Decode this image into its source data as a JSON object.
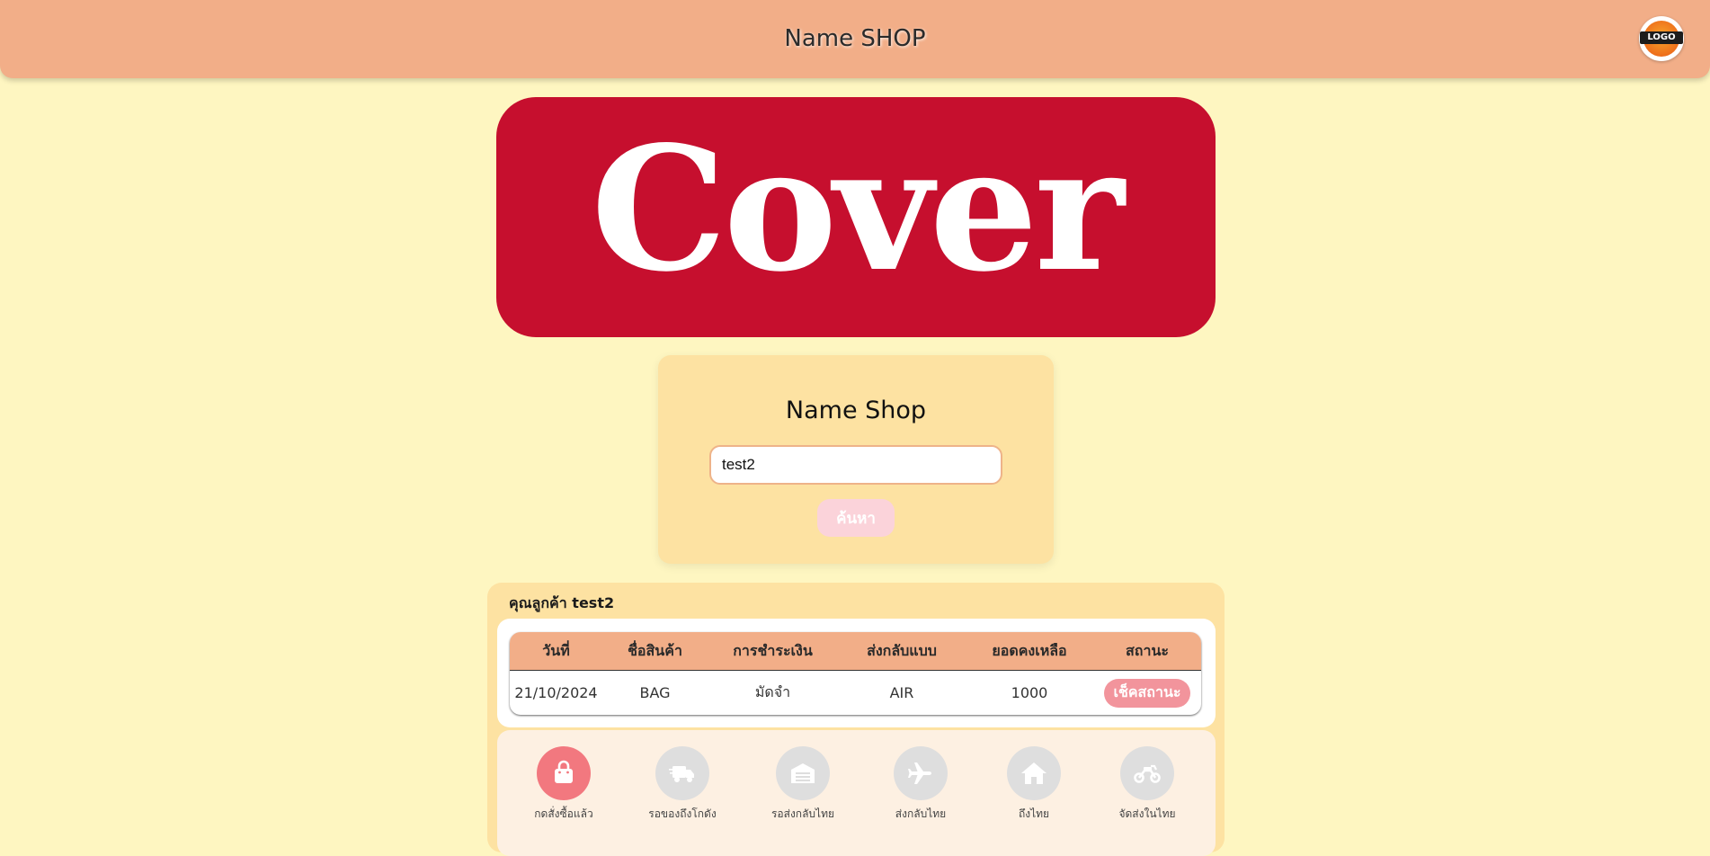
{
  "header": {
    "title": "Name SHOP",
    "logo_text": "LOGO"
  },
  "cover": {
    "word": "Cover",
    "background": "#c60f2e"
  },
  "search": {
    "title": "Name Shop",
    "input_value": "test2",
    "button_label": "ค้นหา"
  },
  "customer": {
    "label": "คุณลูกค้า test2"
  },
  "orders": {
    "columns": [
      "วันที่",
      "ชื่อสินค้า",
      "การชำระเงิน",
      "ส่งกลับแบบ",
      "ยอดคงเหลือ",
      "สถานะ"
    ],
    "rows": [
      {
        "date": "21/10/2024",
        "product": "BAG",
        "payment": "มัดจำ",
        "shipping": "AIR",
        "balance": "1000",
        "status_button": "เช็คสถานะ"
      }
    ]
  },
  "tracking": {
    "active_step": 0,
    "steps": [
      {
        "label": "กดสั่งซื้อแล้ว",
        "icon": "shopping-bag-icon"
      },
      {
        "label": "รอของถึงโกดัง",
        "icon": "delivery-truck-icon"
      },
      {
        "label": "รอส่งกลับไทย",
        "icon": "warehouse-icon"
      },
      {
        "label": "ส่งกลับไทย",
        "icon": "airplane-icon"
      },
      {
        "label": "ถึงไทย",
        "icon": "home-icon"
      },
      {
        "label": "จัดส่งในไทย",
        "icon": "motorcycle-icon"
      }
    ]
  },
  "colors": {
    "page_bg": "#fef6c1",
    "header_bg": "#f2ae88",
    "card_bg": "#fde2a2",
    "accent_pink": "#f2787f",
    "inactive_step": "#dedede"
  }
}
